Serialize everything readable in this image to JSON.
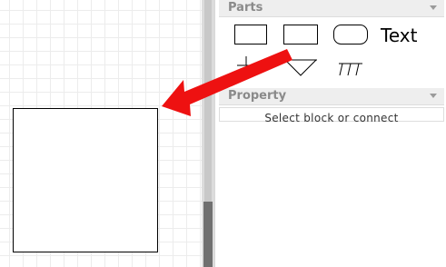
{
  "panel": {
    "parts_title": "Parts",
    "property_title": "Property",
    "status_text": "Select block or connect"
  },
  "parts": {
    "items": [
      {
        "icon": "rectangle-icon"
      },
      {
        "icon": "rectangle-icon"
      },
      {
        "icon": "rounded-rectangle-icon"
      },
      {
        "icon": "text-tool",
        "label": "Text"
      },
      {
        "icon": "ground-icon"
      },
      {
        "icon": "triangle-icon"
      },
      {
        "icon": "hatch-icon"
      }
    ]
  },
  "colors": {
    "arrow": "#ee1111",
    "header_bg": "#eeeeee",
    "header_text": "#8a8a8a",
    "scroll_thumb": "#707070"
  }
}
